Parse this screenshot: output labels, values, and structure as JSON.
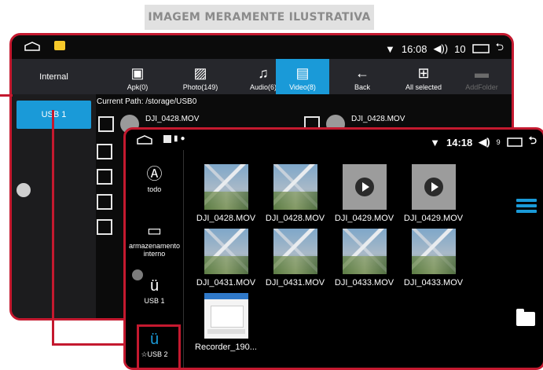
{
  "banner": "IMAGEM MERAMENTE ILUSTRATIVA",
  "back": {
    "status": {
      "time": "16:08",
      "volume": "10"
    },
    "internal_label": "Internal",
    "toolbar": [
      {
        "label": "Apk(0)",
        "icon": "android-apk-icon"
      },
      {
        "label": "Photo(149)",
        "icon": "photo-icon"
      },
      {
        "label": "Audio(6)",
        "icon": "music-note-icon"
      },
      {
        "label": "Video(8)",
        "icon": "video-icon",
        "active": true
      },
      {
        "label": "Back",
        "icon": "back-arrow-icon"
      },
      {
        "label": "All selected",
        "icon": "grid-select-icon"
      },
      {
        "label": "AddFolder",
        "icon": "add-folder-icon",
        "disabled": true
      }
    ],
    "usb_label": "USB 1",
    "current_path": "Current Path: /storage/USB0",
    "files": [
      "DJI_0428.MOV",
      "DJI_0428.MOV"
    ]
  },
  "front": {
    "status": {
      "time": "14:18",
      "volume": "9"
    },
    "nav": [
      {
        "label": "todo",
        "icon": "all-icon"
      },
      {
        "label": "armazenamento interno",
        "icon": "internal-storage-icon"
      },
      {
        "label": "USB 1",
        "icon": "usb-icon"
      },
      {
        "label": "☆USB 2",
        "icon": "usb-icon",
        "active": true
      }
    ],
    "tiles": [
      {
        "name": "DJI_0428.MOV",
        "kind": "aerial"
      },
      {
        "name": "DJI_0428.MOV",
        "kind": "aerial"
      },
      {
        "name": "DJI_0429.MOV",
        "kind": "video"
      },
      {
        "name": "DJI_0429.MOV",
        "kind": "video"
      },
      {
        "name": "DJI_0431.MOV",
        "kind": "aerial"
      },
      {
        "name": "DJI_0431.MOV",
        "kind": "aerial"
      },
      {
        "name": "DJI_0433.MOV",
        "kind": "aerial"
      },
      {
        "name": "DJI_0433.MOV",
        "kind": "aerial"
      },
      {
        "name": "Recorder_190...",
        "kind": "screenshot"
      }
    ]
  },
  "colors": {
    "accent": "#1a9ad8",
    "highlight": "#c4192f"
  }
}
